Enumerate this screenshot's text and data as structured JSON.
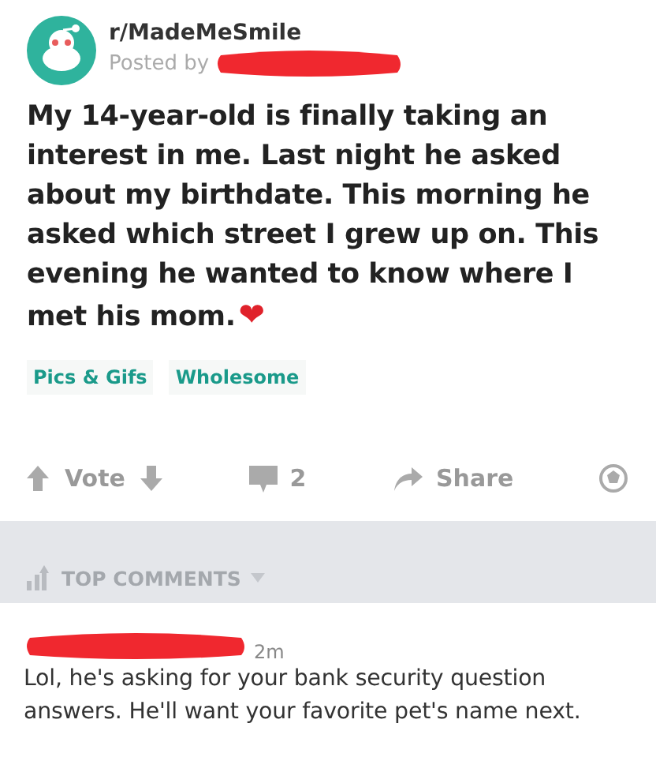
{
  "post": {
    "subreddit": "r/MadeMeSmile",
    "posted_by": "Posted by",
    "title": "My 14-year-old is finally taking an interest in me. Last night he asked about my birthdate. This morning he asked which street I grew up on. This evening he wanted to know where I met his mom.❤",
    "tags": [
      "Pics & Gifs",
      "Wholesome"
    ],
    "vote": "Vote",
    "comment_count": "2",
    "share": "Share"
  },
  "comments_header": {
    "label": "TOP COMMENTS"
  },
  "comments": [
    {
      "time": "2m",
      "text": "Lol, he's asking for your bank security question answers. He'll want your favorite pet's name next."
    }
  ]
}
